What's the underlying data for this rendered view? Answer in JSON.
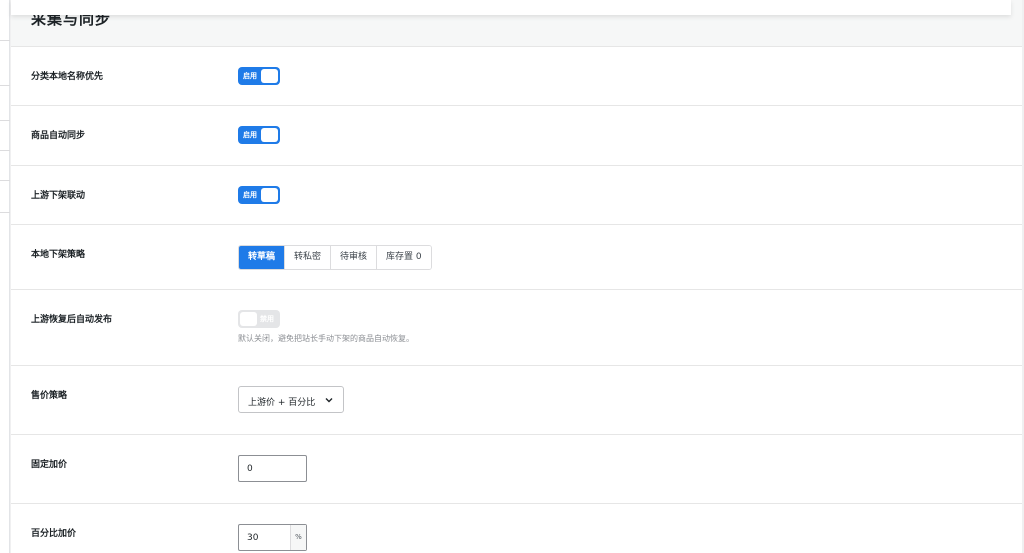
{
  "section": {
    "title": "采集与同步"
  },
  "rows": {
    "category_name": {
      "label": "分类本地名称优先",
      "toggle": "启用"
    },
    "auto_sync": {
      "label": "商品自动同步",
      "toggle": "启用"
    },
    "upstream_delist": {
      "label": "上游下架联动",
      "toggle": "启用"
    },
    "delist_strategy": {
      "label": "本地下架策略",
      "options": [
        "转草稿",
        "转私密",
        "待审核",
        "库存置 0"
      ],
      "selected": "转草稿"
    },
    "auto_republish": {
      "label": "上游恢复后自动发布",
      "toggle": "禁用",
      "hint": "默认关闭，避免把站长手动下架的商品自动恢复。"
    },
    "price_strategy": {
      "label": "售价策略",
      "value": "上游价 + 百分比"
    },
    "fixed_markup": {
      "label": "固定加价",
      "value": "0"
    },
    "percent_markup": {
      "label": "百分比加价",
      "value": "30",
      "suffix": "%"
    }
  },
  "colors": {
    "accent": "#1f7be8",
    "toggle_off": "#e4e5e7"
  }
}
